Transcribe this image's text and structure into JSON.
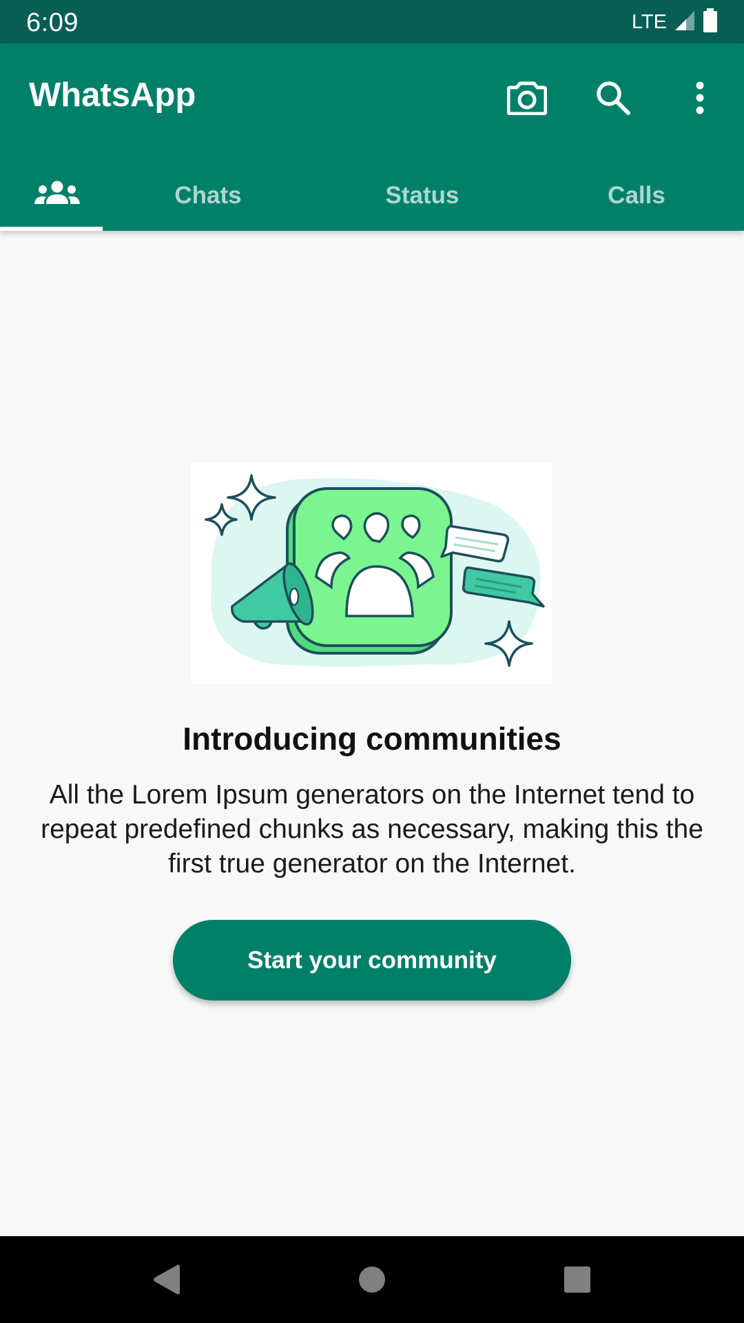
{
  "status_bar": {
    "time": "6:09",
    "network": "LTE",
    "icons": [
      "signal-icon",
      "battery-icon"
    ]
  },
  "app_bar": {
    "title": "WhatsApp",
    "actions": [
      "camera-icon",
      "search-icon",
      "more-options-icon"
    ]
  },
  "tabs": {
    "items": [
      {
        "label": "",
        "icon": "communities-icon",
        "selected": true
      },
      {
        "label": "Chats",
        "selected": false
      },
      {
        "label": "Status",
        "selected": false
      },
      {
        "label": "Calls",
        "selected": false
      }
    ]
  },
  "main": {
    "illustration_icon": "communities-illustration",
    "title": "Introducing communities",
    "body": "All the Lorem Ipsum generators on the Internet tend to repeat predefined chunks as necessary, making this the first true generator on the Internet.",
    "button_label": "Start your community"
  },
  "nav_bar": {
    "buttons": [
      "back-icon",
      "home-icon",
      "recents-icon"
    ]
  },
  "colors": {
    "status_bar": "#075e54",
    "app_bar": "#008069",
    "background": "#f8f8f8",
    "illustration_green": "#7bf58f",
    "illustration_teal": "#40c9a2"
  }
}
